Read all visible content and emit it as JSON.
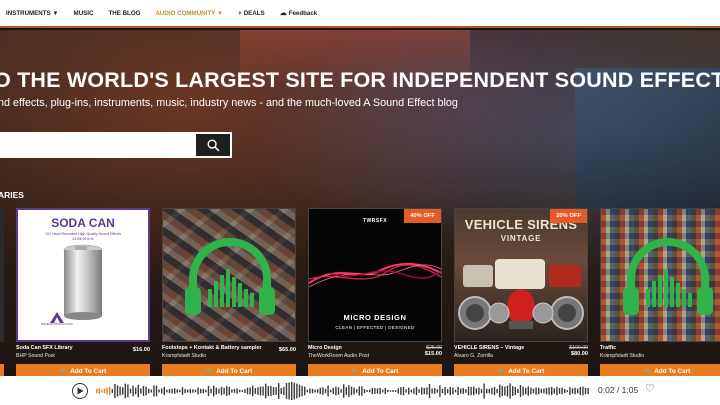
{
  "nav": {
    "items": [
      {
        "label": "INSTRUMENTS",
        "caret": "▼"
      },
      {
        "label": "MUSIC",
        "caret": ""
      },
      {
        "label": "THE BLOG",
        "caret": ""
      },
      {
        "label": "AUDIO COMMUNITY",
        "caret": "▼"
      },
      {
        "label": "DEALS",
        "icon": "fire-icon"
      },
      {
        "label": "Feedback",
        "icon": "chat-icon"
      }
    ]
  },
  "hero": {
    "headline": "O THE WORLD'S LARGEST SITE FOR INDEPENDENT SOUND EFFECTS –",
    "subline": "nd effects, plug-ins, instruments, music, industry news - and the much-loved A Sound Effect blog",
    "search_placeholder": "",
    "section_title": "ARIES"
  },
  "cards": [
    {
      "title": "Soda Can SFX Library",
      "vendor": "BHP Sound Post",
      "old_price": "",
      "price": "$16.00",
      "badge": "",
      "cart": "Add To Cart",
      "art": {
        "heading": "SODA CAN",
        "line1": "101 Hand Recorded High Quality Sound Effects",
        "line2": "24 Bit 96 kHz",
        "brand": "BIGHEAD PRODUCTIONS"
      }
    },
    {
      "title": "Footsteps + Kontakt & Battery sampler –",
      "vendor": "Krampfstadt Studio",
      "old_price": "",
      "price": "$65.00",
      "badge": "",
      "cart": "Add To Cart"
    },
    {
      "title": "Micro Design",
      "vendor": "TheWorkRoom Audio Post",
      "old_price": "$25.00",
      "price": "$15.00",
      "badge": "40% OFF",
      "cart": "Add To Cart",
      "art": {
        "logo": "TWRSFX",
        "name": "MICRO DESIGN",
        "tag": "CLEAN | EFFECTED | DESIGNED"
      }
    },
    {
      "title": "VEHICLE SIRENS – Vintage",
      "vendor": "Álvaro G. Zorrilla",
      "old_price": "$100.00",
      "price": "$80.00",
      "badge": "20% OFF",
      "cart": "Add To Cart",
      "art": {
        "name": "VEHICLE SIRENS",
        "sub": "VINTAGE"
      }
    },
    {
      "title": "Traffic",
      "vendor": "Krampfstadt Studio",
      "old_price": "",
      "price": "",
      "badge": "",
      "cart": "Add To Cart"
    }
  ],
  "player": {
    "time": "0:02 / 1:05",
    "progress": 0.03
  },
  "colors": {
    "accent": "#e87c1e",
    "nav_community": "#c69025",
    "badge": "#e65a26",
    "headphones": "#2fb34a"
  }
}
